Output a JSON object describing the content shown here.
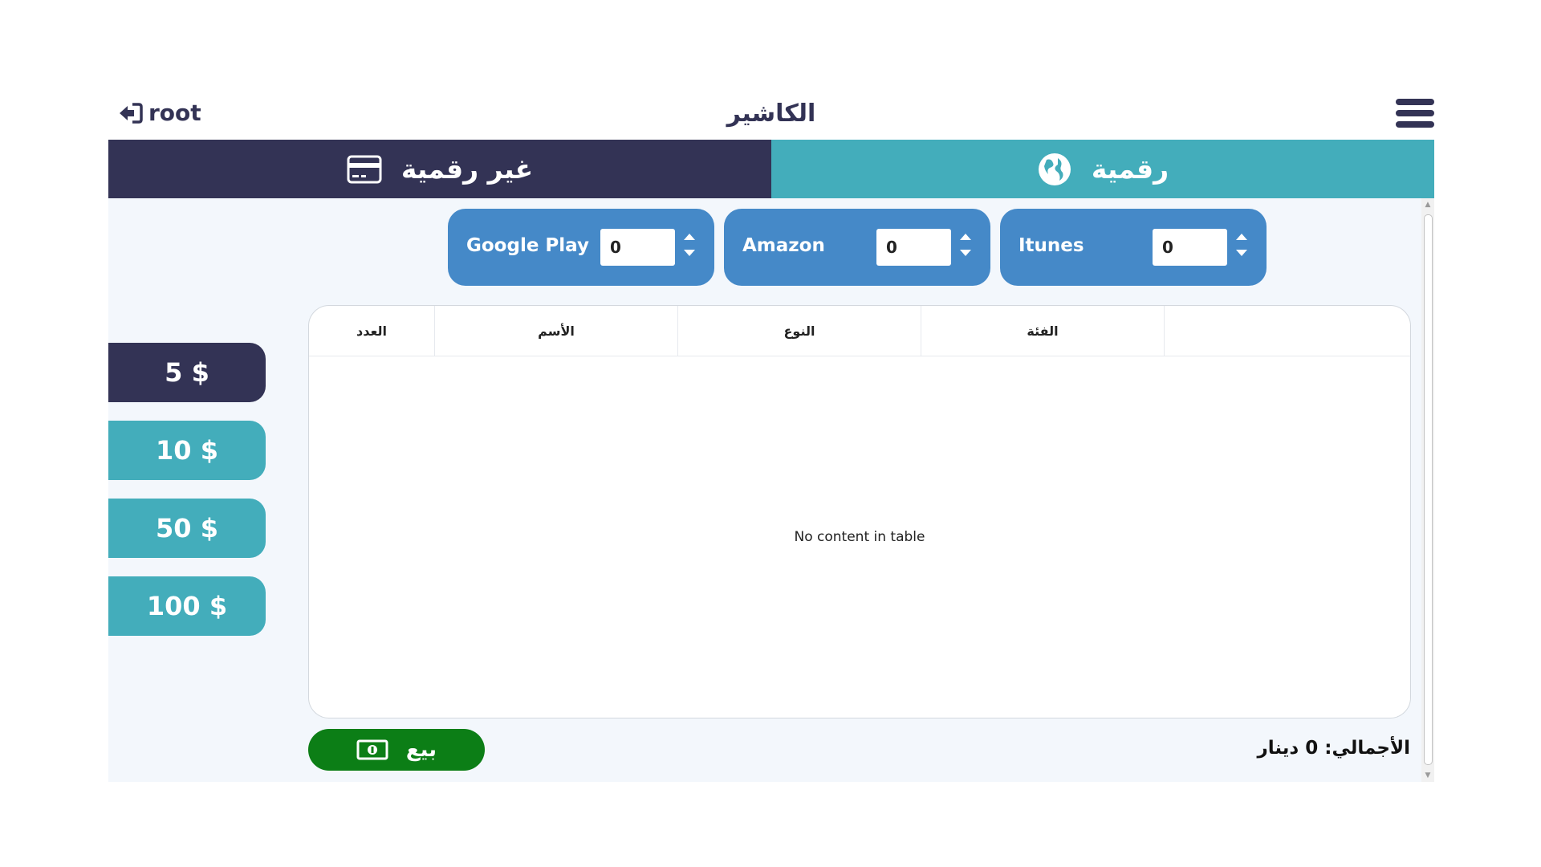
{
  "header": {
    "user": "root",
    "title": "الكاشير"
  },
  "tabs": {
    "non_digital": "غير رقمية",
    "digital": "رقمية"
  },
  "stores": [
    {
      "name": "Google Play",
      "value": "0"
    },
    {
      "name": "Amazon",
      "value": "0"
    },
    {
      "name": "Itunes",
      "value": "0"
    }
  ],
  "amounts": [
    "5 $",
    "10 $",
    "50 $",
    "100 $"
  ],
  "table": {
    "columns": [
      "العدد",
      "الأسم",
      "النوع",
      "الفئة",
      ""
    ],
    "empty_text": "No content in table"
  },
  "footer": {
    "sell_label": "بيع",
    "total_label": "الأجمالي:",
    "total_value": "0",
    "currency": "دينار"
  },
  "colors": {
    "navy": "#333355",
    "teal": "#43adbb",
    "blue": "#4589c8",
    "green": "#0c7e16"
  }
}
